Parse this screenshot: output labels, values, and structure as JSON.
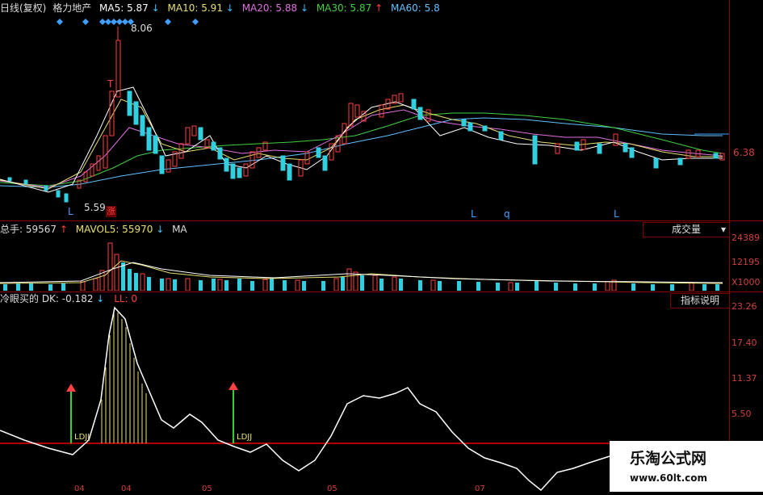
{
  "header": {
    "title": "日线(复权)",
    "stock_name": "格力地产",
    "ma": [
      {
        "label": "MA5: 5.87",
        "arrow": "↓",
        "color": "#ffffff"
      },
      {
        "label": "MA10: 5.91",
        "arrow": "↓",
        "color": "#e8e070"
      },
      {
        "label": "MA20: 5.88",
        "arrow": "↓",
        "color": "#e070e0"
      },
      {
        "label": "MA30: 5.87",
        "arrow": "↑",
        "color": "#40d040"
      },
      {
        "label": "MA60: 5.8",
        "arrow": "",
        "color": "#60c0ff"
      }
    ]
  },
  "price_panel": {
    "high_label": "8.06",
    "low_label": "5.59",
    "right_label": "6.38",
    "markers": [
      "T",
      "L",
      "L",
      "q",
      "L"
    ],
    "badge": "涨"
  },
  "volume_panel": {
    "total_label": "总手: 59567",
    "total_arrow": "↑",
    "mavol5_label": "MAVOL5: 55970",
    "mavol5_arrow": "↓",
    "ma_label": "MA",
    "button": "成交量",
    "dropdown_icon": "▾",
    "axis": [
      "24389",
      "12195",
      "X1000"
    ]
  },
  "indicator_panel": {
    "label": "冷眼买的 DK: -0.182",
    "label_arrow": "↓",
    "ll_label": "LL: 0",
    "button": "指标说明",
    "signals": [
      "LDJJ",
      "LDJJ"
    ],
    "axis": [
      "23.26",
      "17.40",
      "11.37",
      "5.50"
    ]
  },
  "x_axis": [
    "04",
    "04",
    "05",
    "05",
    "07"
  ],
  "watermark": {
    "title": "乐淘公式网",
    "url": "www.60lt.com"
  }
}
